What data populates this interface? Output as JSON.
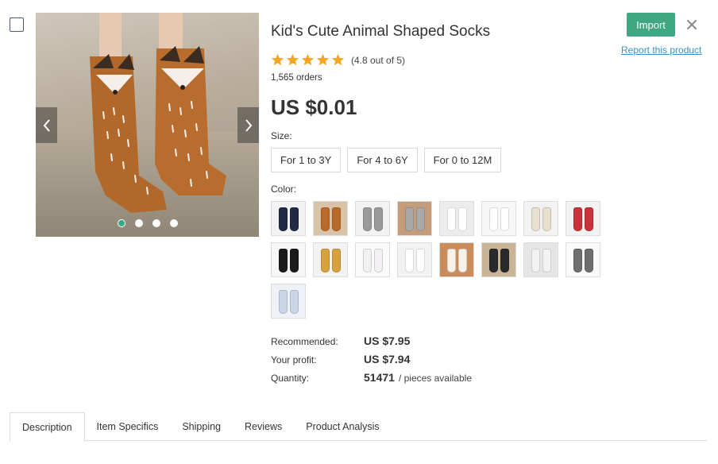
{
  "product": {
    "title": "Kid's Cute Animal Shaped Socks",
    "rating_text": "(4.8 out of 5)",
    "rating_value": 4.8,
    "orders": "1,565 orders",
    "price": "US $0.01"
  },
  "actions": {
    "import_label": "Import",
    "report_label": "Report this product"
  },
  "gallery": {
    "slide_count": 4,
    "active_slide": 1
  },
  "size": {
    "label": "Size:",
    "options": [
      "For 1 to 3Y",
      "For 4 to 6Y",
      "For 0 to 12M"
    ]
  },
  "color": {
    "label": "Color:",
    "swatches": [
      {
        "sock": "#1f2a44",
        "bg": "#f2f2f2"
      },
      {
        "sock": "#b96a2a",
        "bg": "#d8c3a8"
      },
      {
        "sock": "#9a9a9a",
        "bg": "#f2f2f2"
      },
      {
        "sock": "#a9a9a9",
        "bg": "#c59c7a"
      },
      {
        "sock": "#ffffff",
        "bg": "#ececec"
      },
      {
        "sock": "#ffffff",
        "bg": "#f7f7f7"
      },
      {
        "sock": "#e8dfcf",
        "bg": "#f2f2f2"
      },
      {
        "sock": "#c8323a",
        "bg": "#f2f2f2"
      },
      {
        "sock": "#1b1b1b",
        "bg": "#f7f7f7"
      },
      {
        "sock": "#d7a13f",
        "bg": "#f2f2f2"
      },
      {
        "sock": "#f3f0f4",
        "bg": "#fafafa"
      },
      {
        "sock": "#ffffff",
        "bg": "#f2f2f2"
      },
      {
        "sock": "#f7f1ea",
        "bg": "#c98c5a"
      },
      {
        "sock": "#2a2a2a",
        "bg": "#c9b498"
      },
      {
        "sock": "#f2f2f2",
        "bg": "#e5e5e5"
      },
      {
        "sock": "#6e6e6e",
        "bg": "#fafafa"
      },
      {
        "sock": "#c9d6ea",
        "bg": "#eef1f5"
      }
    ]
  },
  "summary": {
    "recommended_label": "Recommended:",
    "recommended_value": "US $7.95",
    "profit_label": "Your profit:",
    "profit_value": "US $7.94",
    "quantity_label": "Quantity:",
    "quantity_value": "51471",
    "quantity_unit": "/ pieces available"
  },
  "tabs": [
    "Description",
    "Item Specifics",
    "Shipping",
    "Reviews",
    "Product Analysis"
  ],
  "colors": {
    "accent": "#3fa883",
    "star": "#f5a623",
    "link": "#3a8fc0"
  }
}
